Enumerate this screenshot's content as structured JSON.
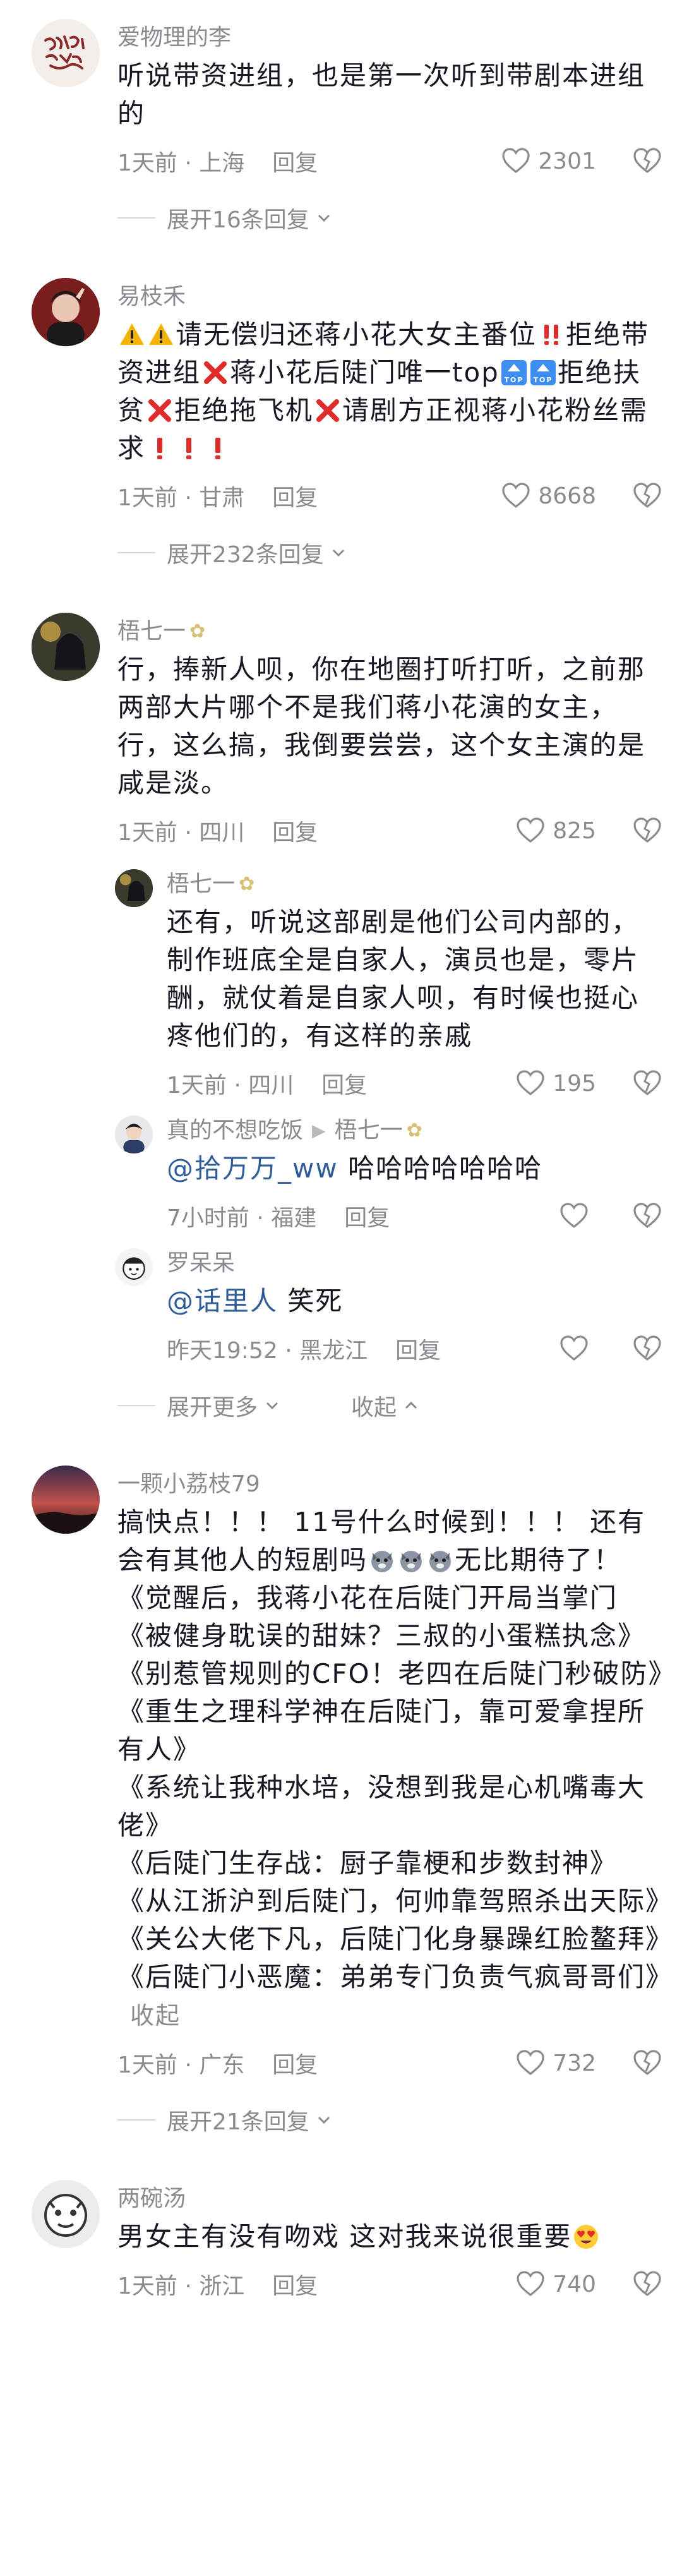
{
  "comments": [
    {
      "user": "爱物理的李",
      "text": "听说带资进组，也是第一次听到带剧本进组的",
      "time": "1天前 · 上海",
      "reply_label": "回复",
      "likes": "2301",
      "expand": "展开16条回复"
    },
    {
      "user": "易枝禾",
      "text_parts": [
        "请无偿归还蒋小花大女主番位",
        "拒绝带资进组",
        "蒋小花后陡门唯一top",
        "拒绝扶贫",
        "拒绝拖飞机",
        "请剧方正视蒋小花粉丝需求"
      ],
      "time": "1天前 · 甘肃",
      "reply_label": "回复",
      "likes": "8668",
      "expand": "展开232条回复"
    },
    {
      "user": "梧七一",
      "text": "行，捧新人呗，你在地圈打听打听，之前那两部大片哪个不是我们蒋小花演的女主，行，这么搞，我倒要尝尝，这个女主演的是咸是淡。",
      "time": "1天前 · 四川",
      "reply_label": "回复",
      "likes": "825"
    }
  ],
  "replies": [
    {
      "user": "梧七一",
      "text": "还有，听说这部剧是他们公司内部的，制作班底全是自家人，演员也是，零片酬，就仗着是自家人呗，有时候也挺心疼他们的，有这样的亲戚",
      "time": "1天前 · 四川",
      "reply_label": "回复",
      "likes": "195"
    },
    {
      "user": "真的不想吃饭",
      "reply_to": "梧七一",
      "mention": "@拾万万_ww",
      "text": " 哈哈哈哈哈哈哈",
      "time": "7小时前 · 福建",
      "reply_label": "回复"
    },
    {
      "user": "罗呆呆",
      "mention": "@话里人",
      "text": " 笑死",
      "time": "昨天19:52 · 黑龙江",
      "reply_label": "回复"
    }
  ],
  "thread_controls": {
    "more": "展开更多",
    "collapse": "收起"
  },
  "long_comment": {
    "user": "一颗小荔枝79",
    "intro": "搞快点！！！ 11号什么时候到！！！ 还有会有其他人的短剧吗",
    "intro_tail": "无比期待了！",
    "titles": [
      "《觉醒后，我蒋小花在后陡门开局当掌门",
      "《被健身耽误的甜妹？三叔的小蛋糕执念》",
      "《别惹管规则的CFO！老四在后陡门秒破防》",
      "《重生之理科学神在后陡门，靠可爱拿捏所有人》",
      "《系统让我种水培，没想到我是心机嘴毒大佬》",
      "《后陡门生存战：厨子靠梗和步数封神》",
      "《从江浙沪到后陡门，何帅靠驾照杀出天际》",
      "《关公大佬下凡，后陡门化身暴躁红脸鳌拜》",
      "《后陡门小恶魔：弟弟专门负责气疯哥哥们》"
    ],
    "collapse_link": "收起",
    "time": "1天前 · 广东",
    "reply_label": "回复",
    "likes": "732",
    "expand": "展开21条回复"
  },
  "last_comment": {
    "user": "两碗汤",
    "text": "男女主有没有吻戏 这对我来说很重要",
    "time": "1天前 · 浙江",
    "reply_label": "回复",
    "likes": "740"
  },
  "colors": {
    "text": "#161823",
    "muted": "#8a8b91",
    "mention": "#2f5d9a",
    "warning": "#f5b400",
    "red": "#e02b2b",
    "top_blue": "#3d8ef0"
  }
}
